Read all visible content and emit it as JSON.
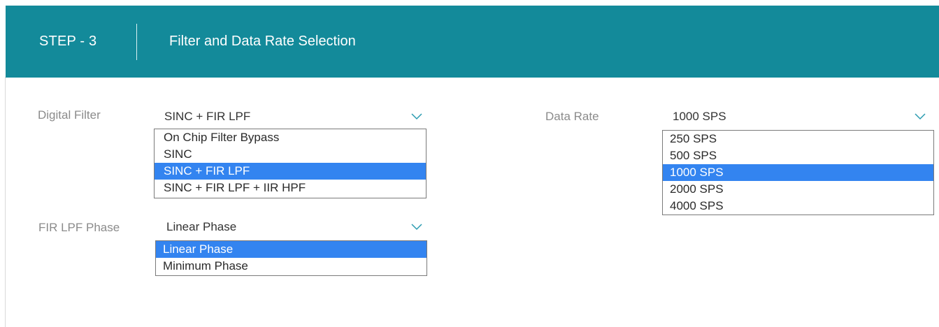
{
  "header": {
    "step": "STEP - 3",
    "title": "Filter and Data Rate Selection",
    "background_color": "#138a9a"
  },
  "digital_filter": {
    "label": "Digital Filter",
    "value": "SINC + FIR LPF",
    "icon": "chevron-down-icon",
    "options": [
      "On Chip Filter Bypass",
      "SINC",
      "SINC + FIR LPF",
      "SINC + FIR LPF + IIR HPF"
    ],
    "selected_index": 2
  },
  "fir_lpf_phase": {
    "label": "FIR LPF Phase",
    "value": "Linear Phase",
    "icon": "chevron-down-icon",
    "options": [
      "Linear Phase",
      "Minimum Phase"
    ],
    "selected_index": 0
  },
  "data_rate": {
    "label": "Data Rate",
    "value": "1000 SPS",
    "icon": "chevron-down-icon",
    "options": [
      "250 SPS",
      "500 SPS",
      "1000 SPS",
      "2000 SPS",
      "4000 SPS"
    ],
    "selected_index": 2
  },
  "colors": {
    "selected_option": "#3384f0",
    "label_text": "#8b8b8b",
    "chevron": "#2a9bb0"
  }
}
